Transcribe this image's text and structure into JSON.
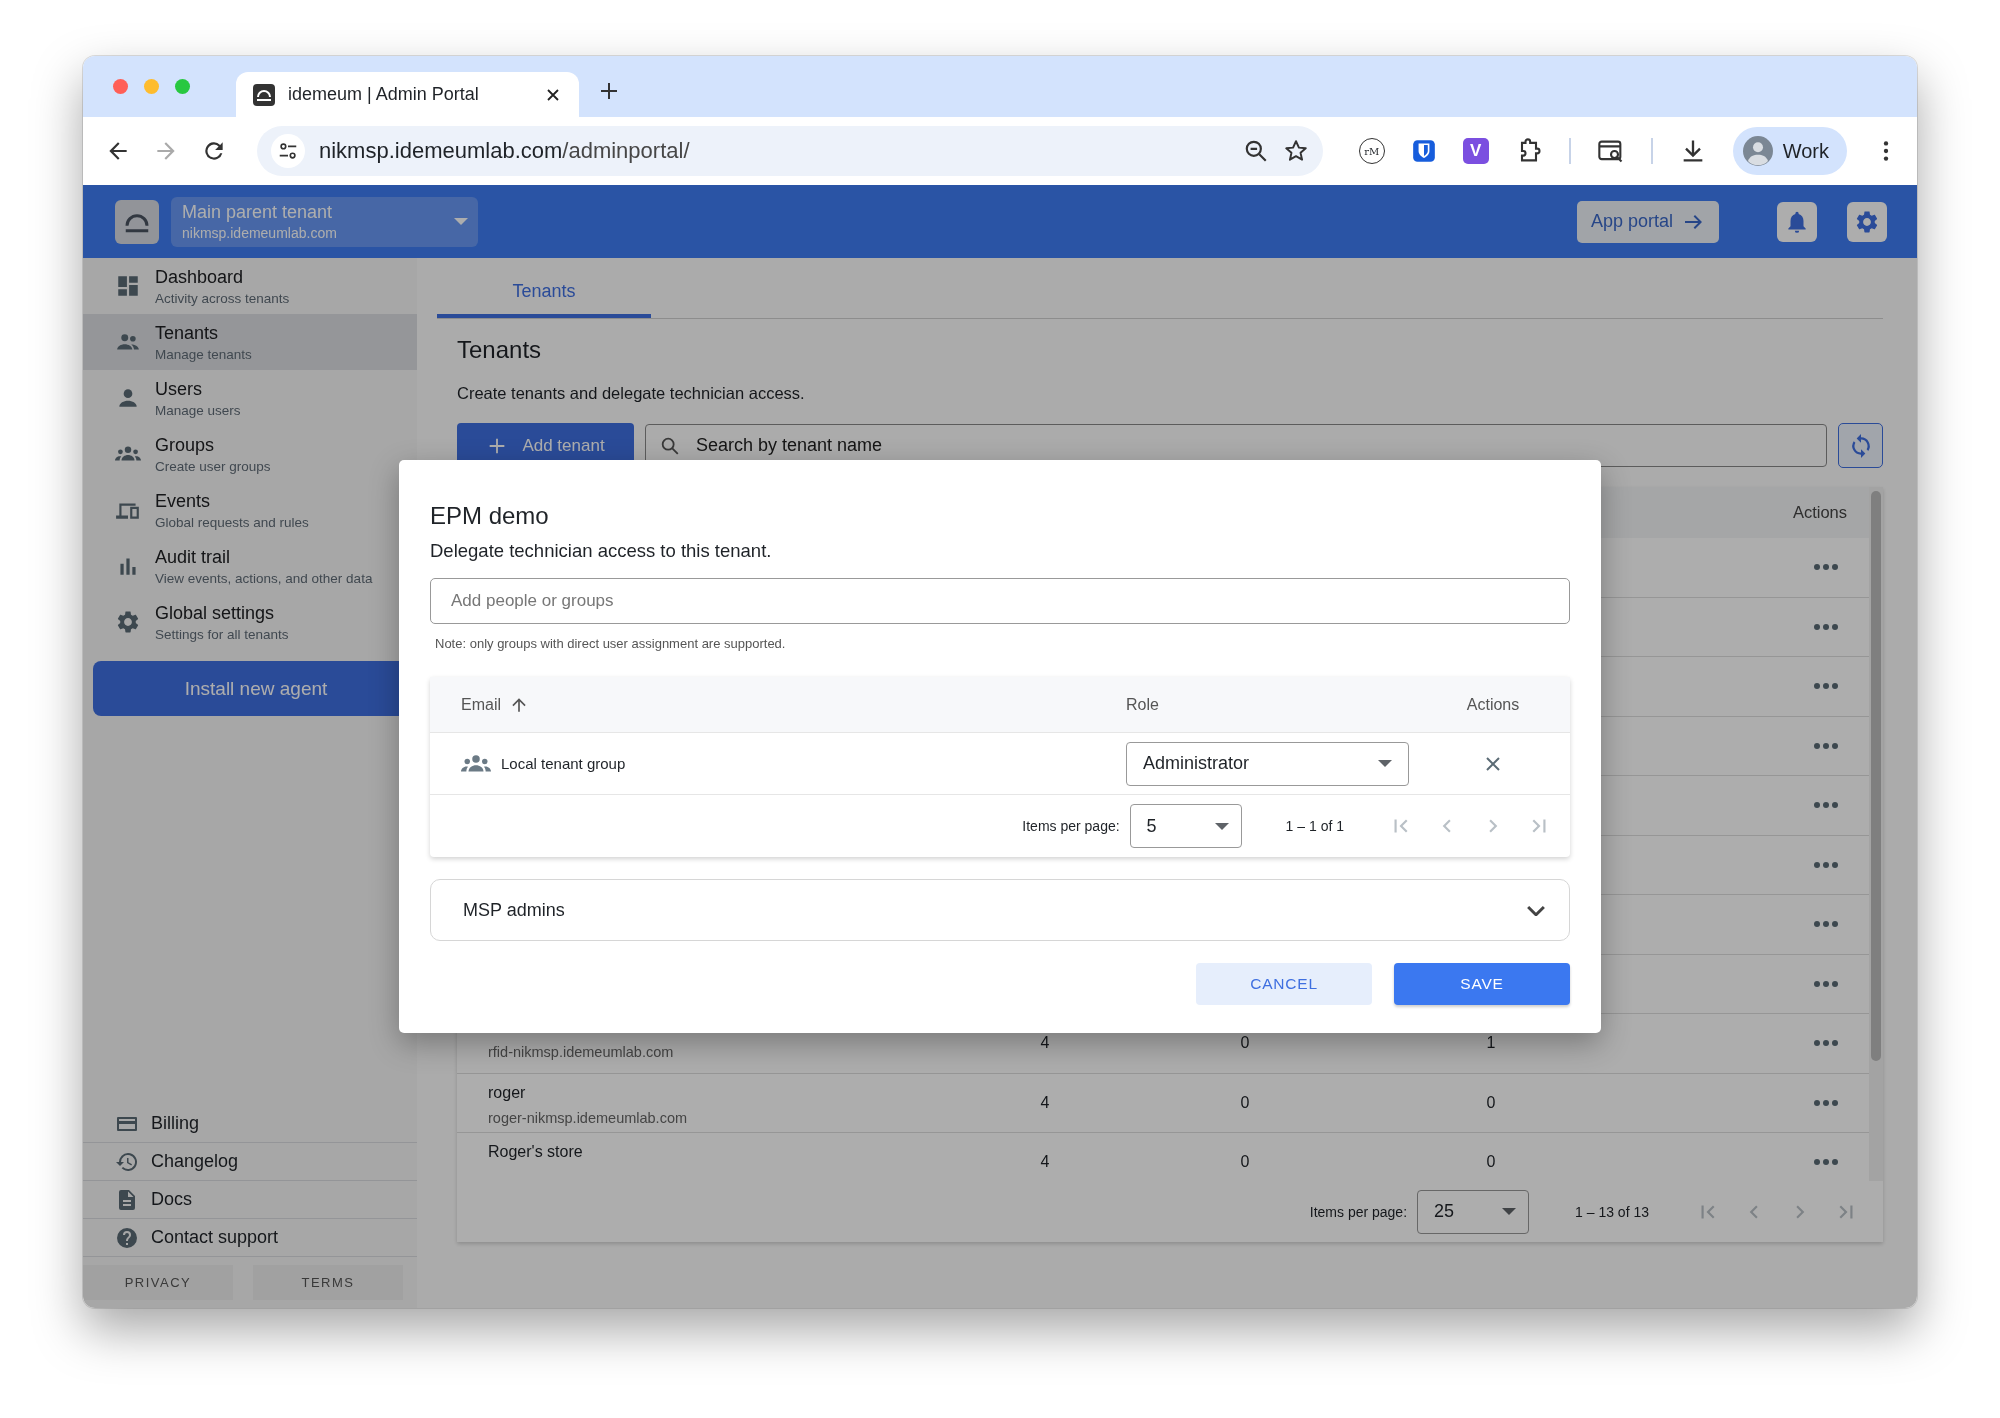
{
  "browser": {
    "tab_title": "idemeum | Admin Portal",
    "url_host": "nikmsp.idemeumlab.com",
    "url_path": "/adminportal/",
    "extensions": [
      {
        "kind": "circle",
        "label": "rM"
      },
      {
        "kind": "shield"
      },
      {
        "kind": "square",
        "label": "V"
      },
      {
        "kind": "puzzle"
      }
    ],
    "profile": "Work"
  },
  "header": {
    "tenant_name": "Main parent tenant",
    "tenant_domain": "nikmsp.idemeumlab.com",
    "app_portal": "App portal"
  },
  "sidebar": {
    "items": [
      {
        "kind": "dashboard",
        "label": "Dashboard",
        "sublabel": "Activity across tenants",
        "selected": false
      },
      {
        "kind": "tenants",
        "label": "Tenants",
        "sublabel": "Manage tenants",
        "selected": true
      },
      {
        "kind": "users",
        "label": "Users",
        "sublabel": "Manage users",
        "selected": false
      },
      {
        "kind": "groups",
        "label": "Groups",
        "sublabel": "Create user groups",
        "selected": false
      },
      {
        "kind": "events",
        "label": "Events",
        "sublabel": "Global requests and rules",
        "selected": false
      },
      {
        "kind": "audit",
        "label": "Audit trail",
        "sublabel": "View events, actions, and other data",
        "selected": false
      },
      {
        "kind": "settings",
        "label": "Global settings",
        "sublabel": "Settings for all tenants",
        "selected": false
      }
    ],
    "install_button": "Install new agent",
    "footer_links": [
      {
        "kind": "billing",
        "label": "Billing"
      },
      {
        "kind": "changelog",
        "label": "Changelog"
      },
      {
        "kind": "docs",
        "label": "Docs"
      },
      {
        "kind": "support",
        "label": "Contact support"
      }
    ],
    "legal": [
      "PRIVACY",
      "TERMS"
    ]
  },
  "main": {
    "tabs": [
      {
        "label": "Tenants",
        "selected": true
      }
    ],
    "title": "Tenants",
    "description": "Create tenants and delegate technician access.",
    "add_button": "Add tenant",
    "search": {
      "placeholder": "Search by tenant name"
    },
    "table": {
      "actions_header": "Actions",
      "rows": [
        {
          "kind": "covered"
        },
        {
          "kind": "covered"
        },
        {
          "kind": "covered"
        },
        {
          "kind": "covered"
        },
        {
          "kind": "covered"
        },
        {
          "kind": "covered"
        },
        {
          "kind": "covered"
        },
        {
          "kind": "covered"
        },
        {
          "kind": "tenant",
          "domain": "rfid-nikmsp.idemeumlab.com",
          "cells": [
            "4",
            "0",
            "1"
          ]
        },
        {
          "kind": "tenant",
          "name": "roger",
          "domain": "roger-nikmsp.idemeumlab.com",
          "cells": [
            "4",
            "0",
            "0"
          ]
        },
        {
          "kind": "tenant",
          "name": "Roger's store",
          "cells": [
            "4",
            "0",
            "0"
          ]
        }
      ],
      "paginator": {
        "label": "Items per page:",
        "page_size": "25",
        "range": "1 – 13 of 13"
      }
    }
  },
  "dialog": {
    "title": "EPM demo",
    "subtitle": "Delegate technician access to this tenant.",
    "input": {
      "placeholder": "Add people or groups"
    },
    "note": "Note: only groups with direct user assignment are supported.",
    "table": {
      "columns": [
        {
          "label": "Email",
          "sorted": true
        },
        {
          "label": "Role",
          "sorted": false
        },
        {
          "label": "Actions",
          "sorted": false
        }
      ],
      "rows": [
        {
          "kind": "group",
          "name": "Local tenant group",
          "role": "Administrator"
        }
      ],
      "paginator": {
        "label": "Items per page:",
        "page_size": "5",
        "range": "1 – 1 of 1"
      }
    },
    "panel": {
      "title": "MSP admins",
      "expanded": false
    },
    "buttons": [
      {
        "kind": "secondary",
        "label": "CANCEL"
      },
      {
        "kind": "primary",
        "label": "SAVE"
      }
    ]
  }
}
